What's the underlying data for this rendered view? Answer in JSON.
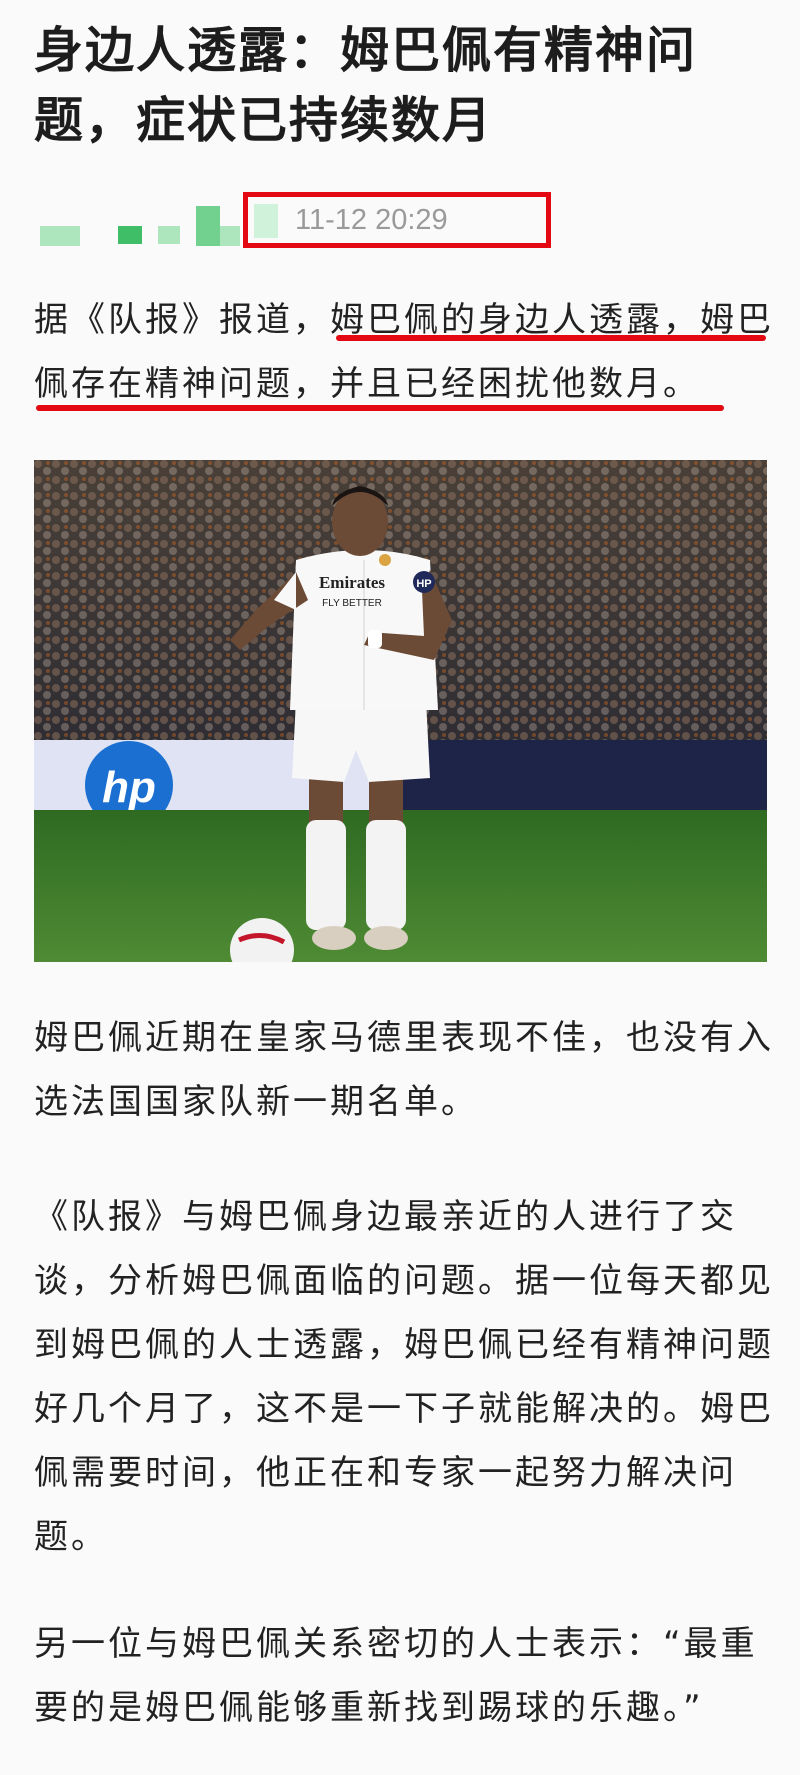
{
  "article": {
    "headline": "身边人透露：姆巴佩有精神问题，症状已持续数月",
    "timestamp": "11-12 20:29",
    "lead_paragraph": "据《队报》报道，姆巴佩的身边人透露，姆巴佩存在精神问题，并且已经困扰他数月。",
    "photo": {
      "jersey_sponsor": "Emirates",
      "jersey_sponsor_sub": "FLY BETTER",
      "board_logo": "hp",
      "sleeve_logo": "HP"
    },
    "paragraphs": [
      "姆巴佩近期在皇家马德里表现不佳，也没有入选法国国家队新一期名单。",
      "《队报》与姆巴佩身边最亲近的人进行了交谈，分析姆巴佩面临的问题。据一位每天都见到姆巴佩的人士透露，姆巴佩已经有精神问题好几个月了，这不是一下子就能解决的。姆巴佩需要时间，他正在和专家一起努力解决问题。",
      "另一位与姆巴佩关系密切的人士表示：“最重要的是姆巴佩能够重新找到踢球的乐趣。”"
    ]
  },
  "colors": {
    "highlight_red": "#e30812",
    "pitch_green": "#3f7d2c",
    "text": "#222222",
    "meta_gray": "#9a9a9a"
  }
}
